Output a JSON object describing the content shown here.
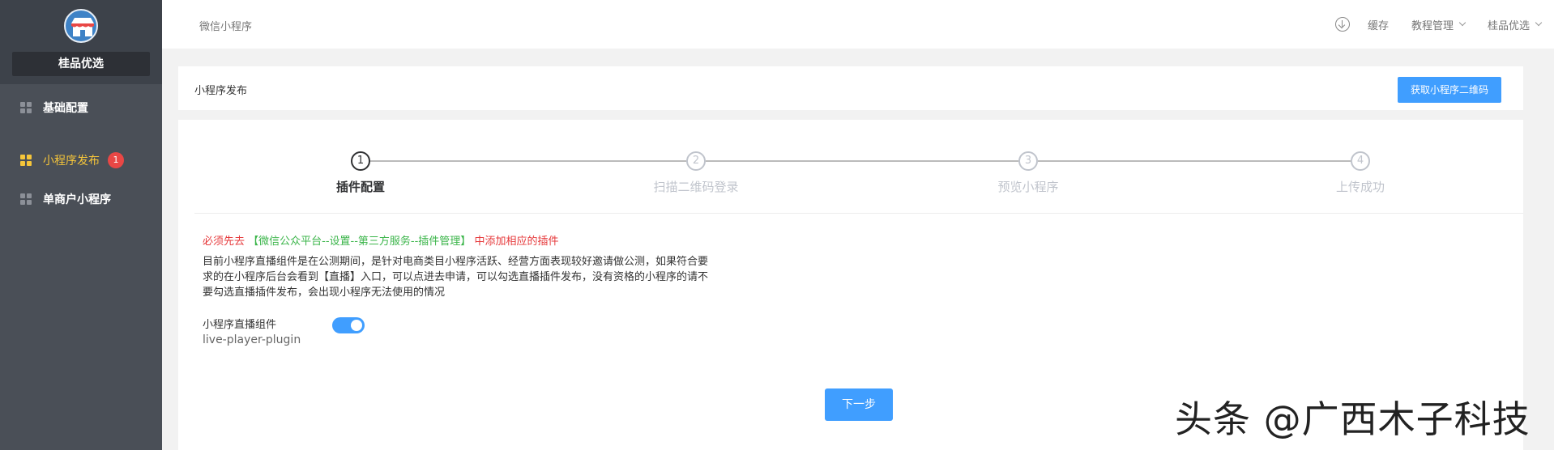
{
  "sidebar": {
    "store_name": "桂品优选",
    "items": [
      {
        "label": "基础配置",
        "active": false
      },
      {
        "label": "小程序发布",
        "active": true,
        "badge": "1"
      },
      {
        "label": "单商户小程序",
        "active": false
      }
    ]
  },
  "topbar": {
    "breadcrumb": "微信小程序",
    "cache": "缓存",
    "tutorial": "教程管理",
    "user": "桂品优选"
  },
  "header": {
    "title": "小程序发布",
    "qr_button": "获取小程序二维码"
  },
  "steps": [
    {
      "number": "1",
      "label": "插件配置",
      "active": true
    },
    {
      "number": "2",
      "label": "扫描二维码登录",
      "active": false
    },
    {
      "number": "3",
      "label": "预览小程序",
      "active": false
    },
    {
      "number": "4",
      "label": "上传成功",
      "active": false
    }
  ],
  "notice": {
    "prefix": "必须先去",
    "path": "【微信公众平台--设置--第三方服务--插件管理】",
    "suffix": "中添加相应的插件"
  },
  "description": "目前小程序直播组件是在公测期间，是针对电商类目小程序活跃、经营方面表现较好邀请做公测，如果符合要求的在小程序后台会看到【直播】入口，可以点进去申请，可以勾选直播插件发布，没有资格的小程序的请不要勾选直播插件发布，会出现小程序无法使用的情况",
  "plugin": {
    "label": "小程序直播组件",
    "id": "live-player-plugin",
    "enabled": true
  },
  "next_button": "下一步",
  "watermark": "头条 @广西木子科技",
  "colors": {
    "sidebar_bg": "#4a4f57",
    "active": "#f5c53a",
    "primary": "#409eff",
    "danger": "#e6393b",
    "success": "#3bb54a"
  }
}
